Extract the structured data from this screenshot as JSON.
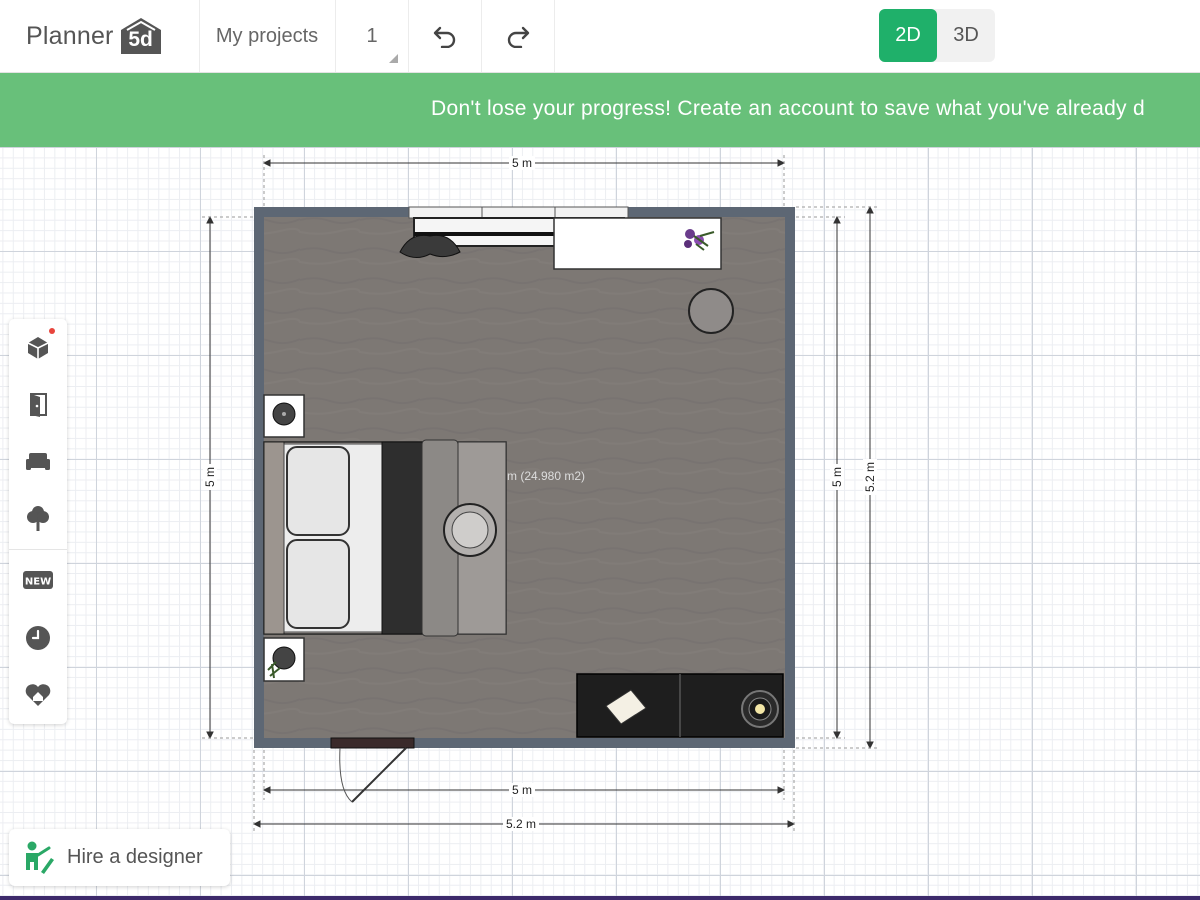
{
  "app": {
    "logo_text": "Planner",
    "logo_badge": "5d"
  },
  "toolbar": {
    "projects_label": "My projects",
    "level_label": "1",
    "undo_icon": "undo-icon",
    "redo_icon": "redo-icon",
    "view_2d_label": "2D",
    "view_3d_label": "3D",
    "active_view": "2D",
    "accent_color": "#1fb06a"
  },
  "banner": {
    "text": "Don't lose your progress! Create an account to save what you've already d",
    "color": "#68c07a"
  },
  "side_tools": [
    {
      "name": "construction-icon",
      "has_notification": true
    },
    {
      "name": "door-icon"
    },
    {
      "name": "furniture-icon"
    },
    {
      "name": "tree-icon"
    },
    {
      "name": "new-badge-icon",
      "label": "NEW"
    },
    {
      "name": "clock-icon"
    },
    {
      "name": "heart-home-icon"
    }
  ],
  "floorplan": {
    "area_label": "m (24.980 m2)",
    "dimensions": {
      "top_inner": "5 m",
      "left_inner": "5 m",
      "right_inner": "5 m",
      "right_outer": "5.2 m",
      "bottom_inner": "5 m",
      "bottom_outer": "5.2 m"
    },
    "furniture": [
      "wardrobe",
      "desk-with-plant",
      "round-stool",
      "bed",
      "nightstand-top",
      "nightstand-bottom",
      "dresser",
      "door"
    ]
  },
  "hire_designer": {
    "label": "Hire a designer"
  }
}
